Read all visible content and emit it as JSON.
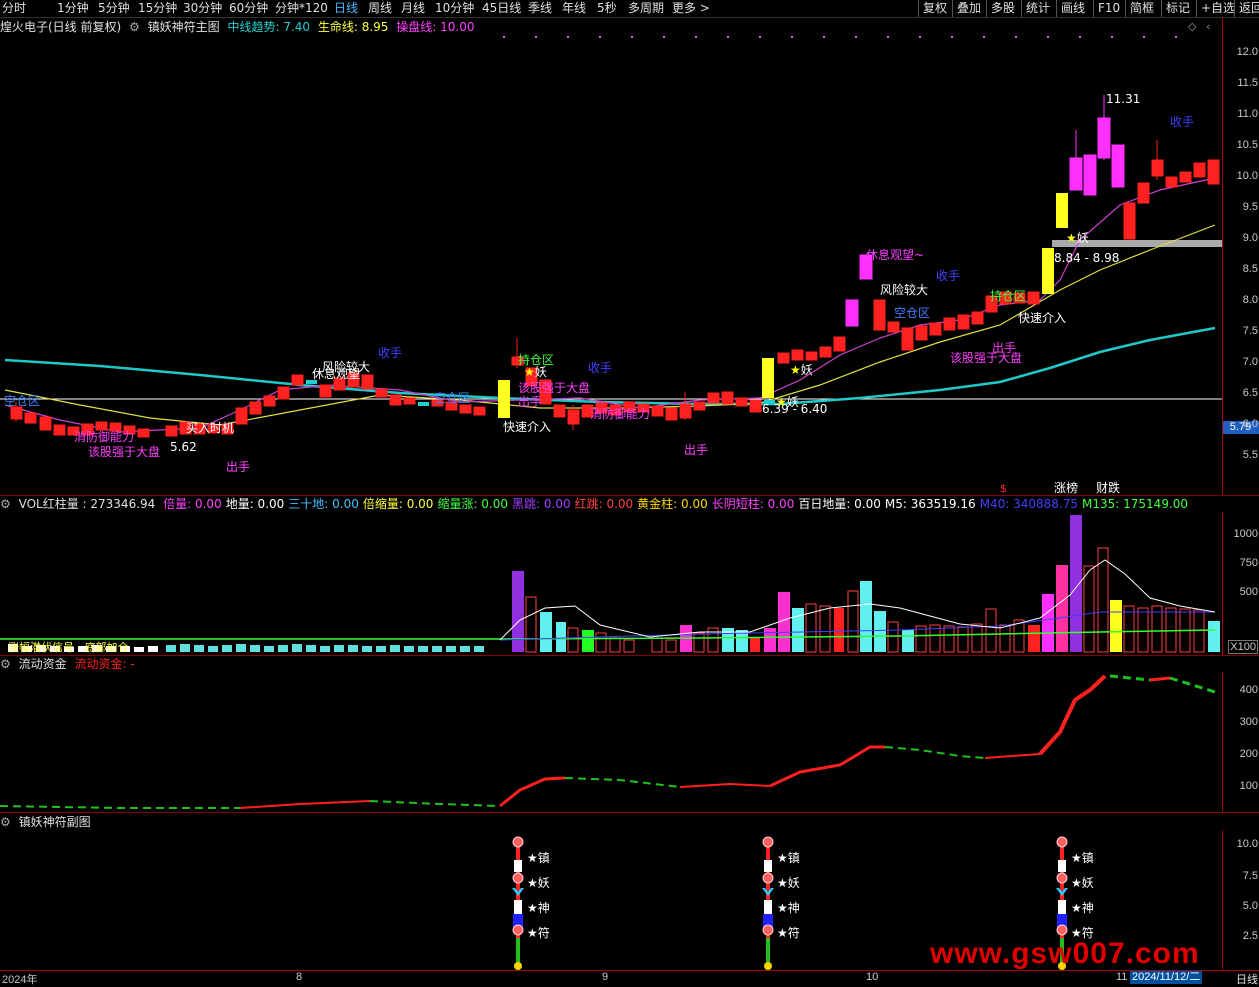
{
  "toolbar": {
    "periods": [
      "分时",
      "1分钟",
      "5分钟",
      "15分钟",
      "30分钟",
      "60分钟",
      "分钟*120",
      "日线",
      "周线",
      "月线",
      "10分钟",
      "45日线",
      "季线",
      "年线",
      "5秒",
      "多周期",
      "更多 >"
    ],
    "active": "日线",
    "right_buttons": [
      "复权",
      "叠加",
      "多股",
      "统计",
      "画线",
      "F10",
      "简框",
      "标记",
      "+自选",
      "返回"
    ]
  },
  "main_panel": {
    "stock": "煌火电子(日线 前复权)",
    "indicator": "镇妖神符主图",
    "trend_label": "中线趋势: 7.40",
    "life_label": "生命线: 8.95",
    "operate_label": "操盘线: 10.00",
    "y_ticks": [
      "12.0",
      "11.5",
      "11.0",
      "10.5",
      "10.0",
      "9.5",
      "9.0",
      "8.5",
      "8.0",
      "7.5",
      "7.0",
      "6.5",
      "6.0",
      "5.5"
    ],
    "current_price": "5.79",
    "annotations": {
      "high": "11.31",
      "low": "5.62",
      "band1": "6.39 - 6.40",
      "band2": "8.84 - 8.98",
      "buy": "买入时机",
      "fast1": "快速介入",
      "fast2": "快速介入",
      "risk1": "风险较大",
      "risk2": "风险较大",
      "rest1": "休息观望",
      "rest2": "休息观望~",
      "hold1": "持仓区",
      "hold2": "持仓区",
      "empty1": "空仓区",
      "empty2": "空仓区",
      "empty3": "空仓区",
      "close1": "收手",
      "close2": "收手",
      "close3": "收手",
      "close4": "收手",
      "out1": "出手",
      "out2": "出手",
      "out3": "出手",
      "out4": "出手",
      "strong1": "该股强于大盘",
      "strong2": "该股强于大盘",
      "strong3": "该股强于大盘",
      "defend1": "消防御能力",
      "defend2": "消防御能力",
      "demon": "妖",
      "rise": "涨榜",
      "fall": "财跌",
      "dollar": "$"
    }
  },
  "vol_panel": {
    "title": "VOL红柱量 : 273346.94",
    "items": [
      {
        "label": "倍量: 0.00",
        "color": "#ff40ff"
      },
      {
        "label": "地量: 0.00",
        "color": "#ffffff"
      },
      {
        "label": "三十地: 0.00",
        "color": "#40c0ff"
      },
      {
        "label": "倍缩量: 0.00",
        "color": "#ffff40"
      },
      {
        "label": "缩量涨: 0.00",
        "color": "#40ff40"
      },
      {
        "label": "黑跳: 0.00",
        "color": "#a040ff"
      },
      {
        "label": "红跳: 0.00",
        "color": "#ff4040"
      },
      {
        "label": "黄金柱: 0.00",
        "color": "#ffd700"
      },
      {
        "label": "长阴短柱: 0.00",
        "color": "#ff40ff"
      },
      {
        "label": "百日地量: 0.00",
        "color": "#ffffff"
      },
      {
        "label": "M5: 363519.16",
        "color": "#ffffff"
      },
      {
        "label": "M40: 340888.75",
        "color": "#4040ff"
      },
      {
        "label": "M135: 175149.00",
        "color": "#40ff40"
      }
    ],
    "y_ticks": [
      "1000",
      "750",
      "500",
      "X100"
    ],
    "left_text": "涨幅潜伏信号 · 底部加仓"
  },
  "flow_panel": {
    "title": "流动资金",
    "sub": "流动资金: -",
    "y_ticks": [
      "400",
      "300",
      "200",
      "100"
    ]
  },
  "sub_panel": {
    "title": "镇妖神符副图",
    "y_ticks": [
      "10.0",
      "7.5",
      "5.0",
      "2.5"
    ],
    "signal_labels": [
      "镇",
      "妖",
      "神",
      "符"
    ]
  },
  "dates": [
    "2024年",
    "8",
    "9",
    "10",
    "11"
  ],
  "date_box": "2024/11/12/二",
  "bottom_right": "日线",
  "watermark": "www.gsw007.com",
  "colors": {
    "up": "#ff2020",
    "down": "#00ffff",
    "magenta": "#ff40ff",
    "yellow": "#ffff00",
    "cyan": "#20d0d0",
    "white": "#ffffff"
  }
}
